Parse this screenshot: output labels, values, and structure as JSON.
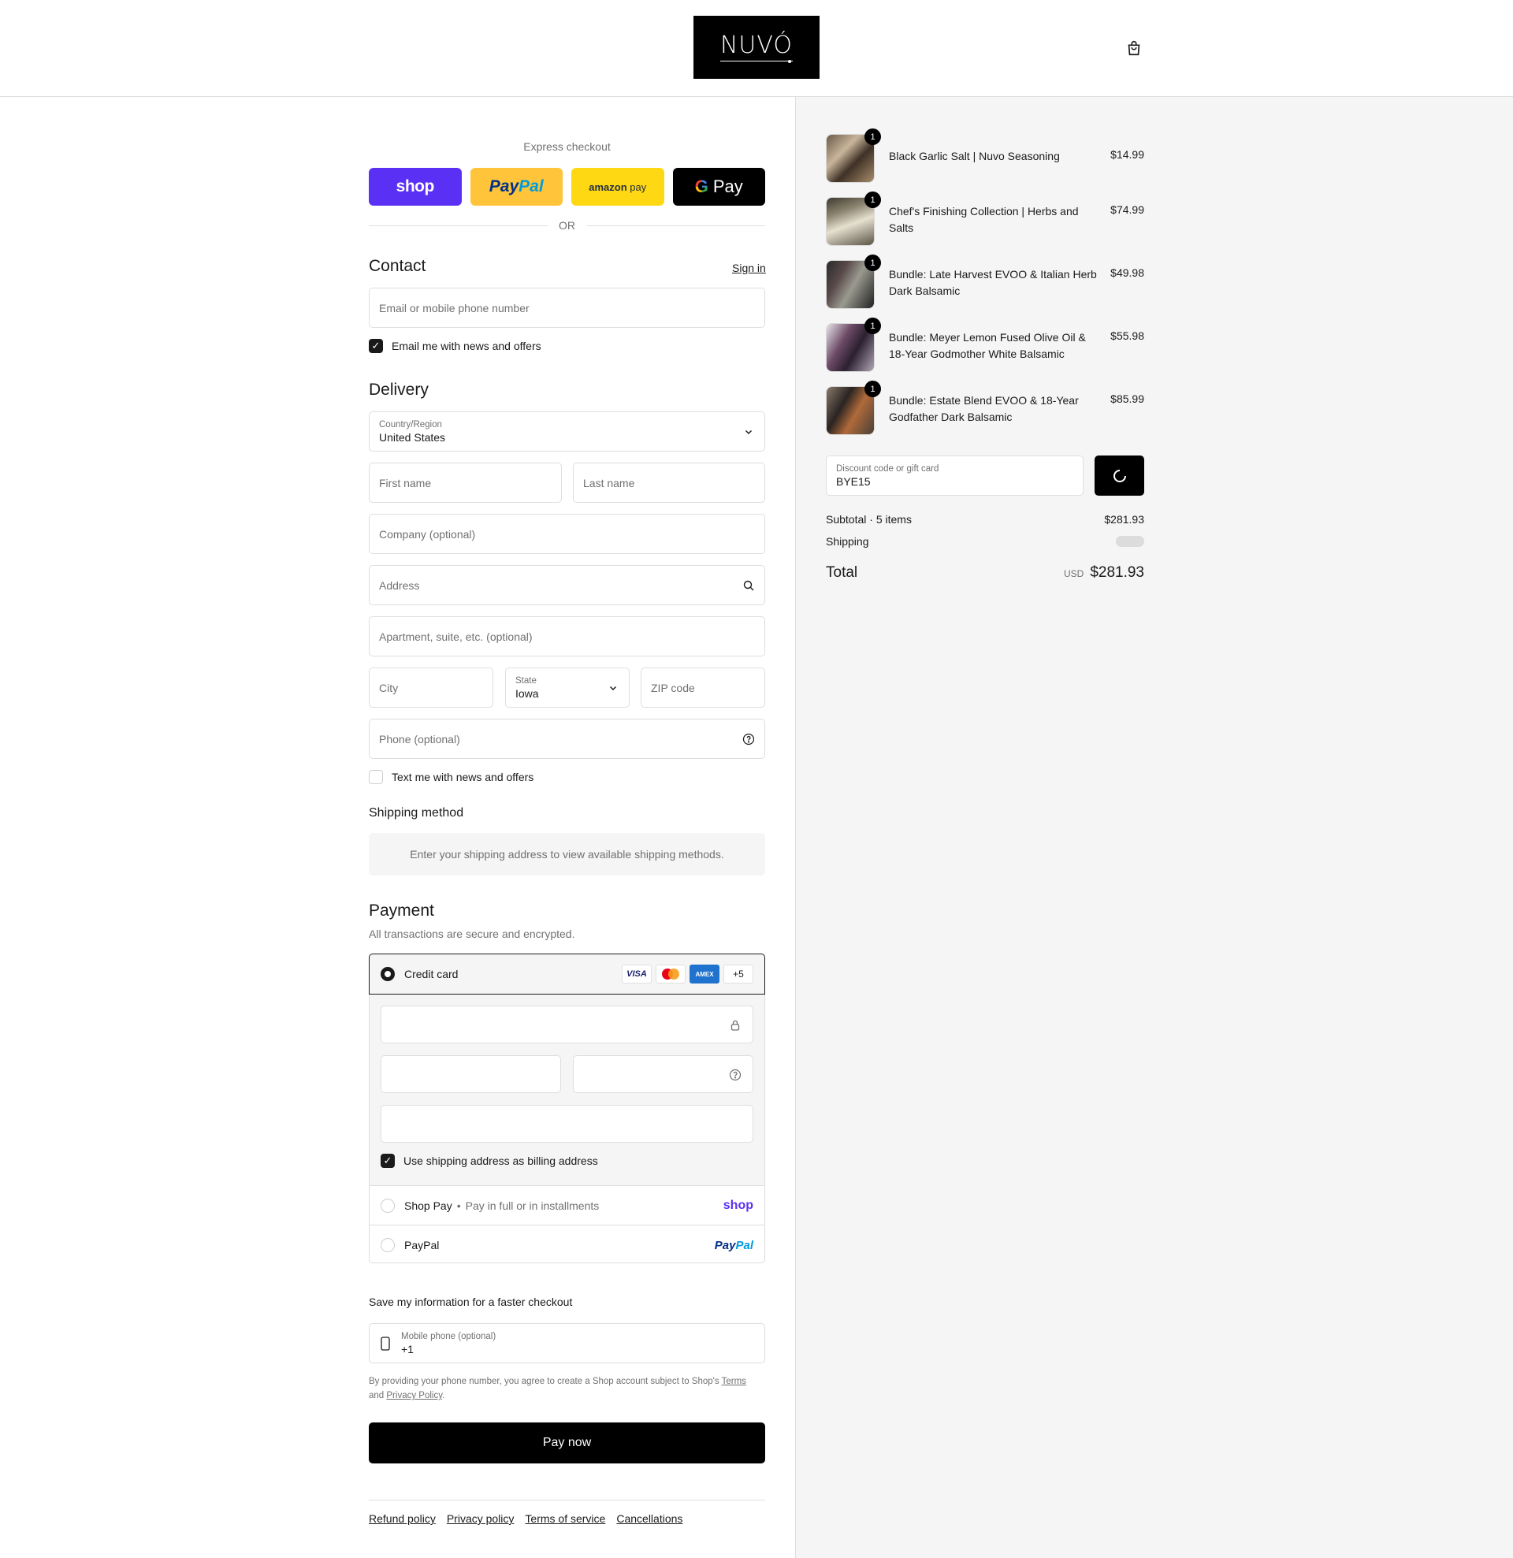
{
  "header": {
    "logo_text": "NUVÓ",
    "cart_icon": "shopping-bag-icon"
  },
  "express": {
    "label": "Express checkout",
    "shop_label": "shop",
    "paypal_label_1": "Pay",
    "paypal_label_2": "Pal",
    "amazon_label_1": "amazon",
    "amazon_label_2": "pay",
    "gpay_label": "Pay",
    "gpay_g": "G",
    "or_label": "OR"
  },
  "contact": {
    "title": "Contact",
    "sign_in": "Sign in",
    "email_placeholder": "Email or mobile phone number",
    "news_label": "Email me with news and offers",
    "news_checked": true
  },
  "delivery": {
    "title": "Delivery",
    "country_label": "Country/Region",
    "country_value": "United States",
    "first_name": "First name",
    "last_name": "Last name",
    "company": "Company (optional)",
    "address": "Address",
    "apartment": "Apartment, suite, etc. (optional)",
    "city": "City",
    "state_label": "State",
    "state_value": "Iowa",
    "zip": "ZIP code",
    "phone": "Phone (optional)",
    "text_label": "Text me with news and offers"
  },
  "shipping_method": {
    "title": "Shipping method",
    "message": "Enter your shipping address to view available shipping methods."
  },
  "payment": {
    "title": "Payment",
    "subtitle": "All transactions are secure and encrypted.",
    "credit_card_label": "Credit card",
    "card_visa": "VISA",
    "card_amex": "AMEX",
    "card_more": "+5",
    "billing_label": "Use shipping address as billing address",
    "shop_pay_label": "Shop Pay",
    "shop_pay_sub": "Pay in full or in installments",
    "shop_pay_logo": "shop",
    "paypal_label": "PayPal",
    "paypal_logo_1": "Pay",
    "paypal_logo_2": "Pal"
  },
  "save_info": {
    "title": "Save my information for a faster checkout",
    "phone_label": "Mobile phone (optional)",
    "phone_value": "+1",
    "disclaimer_1": "By providing your phone number, you agree to create a Shop account subject to Shop's ",
    "terms": "Terms",
    "disclaimer_2": "and ",
    "privacy": "Privacy Policy",
    "disclaimer_3": "."
  },
  "pay_now": "Pay now",
  "footer": {
    "links": [
      "Refund policy",
      "Privacy policy",
      "Terms of service",
      "Cancellations"
    ]
  },
  "summary": {
    "items": [
      {
        "name": "Black Garlic Salt | Nuvo Seasoning",
        "price": "$14.99",
        "qty": "1"
      },
      {
        "name": "Chef's Finishing Collection | Herbs and Salts",
        "price": "$74.99",
        "qty": "1"
      },
      {
        "name": "Bundle: Late Harvest EVOO & Italian Herb Dark Balsamic",
        "price": "$49.98",
        "qty": "1"
      },
      {
        "name": "Bundle: Meyer Lemon Fused Olive Oil & 18-Year Godmother White Balsamic",
        "price": "$55.98",
        "qty": "1"
      },
      {
        "name": "Bundle: Estate Blend EVOO & 18-Year Godfather Dark Balsamic",
        "price": "$85.99",
        "qty": "1"
      }
    ],
    "discount_label": "Discount code or gift card",
    "discount_value": "BYE15",
    "subtotal_label": "Subtotal · 5 items",
    "subtotal_value": "$281.93",
    "shipping_label": "Shipping",
    "total_label": "Total",
    "total_currency": "USD",
    "total_value": "$281.93"
  },
  "colors": {
    "shop_purple": "#5a31f4",
    "paypal_yellow": "#ffc439",
    "amazon_yellow": "#ffd814",
    "summary_bg": "#f5f5f5"
  }
}
